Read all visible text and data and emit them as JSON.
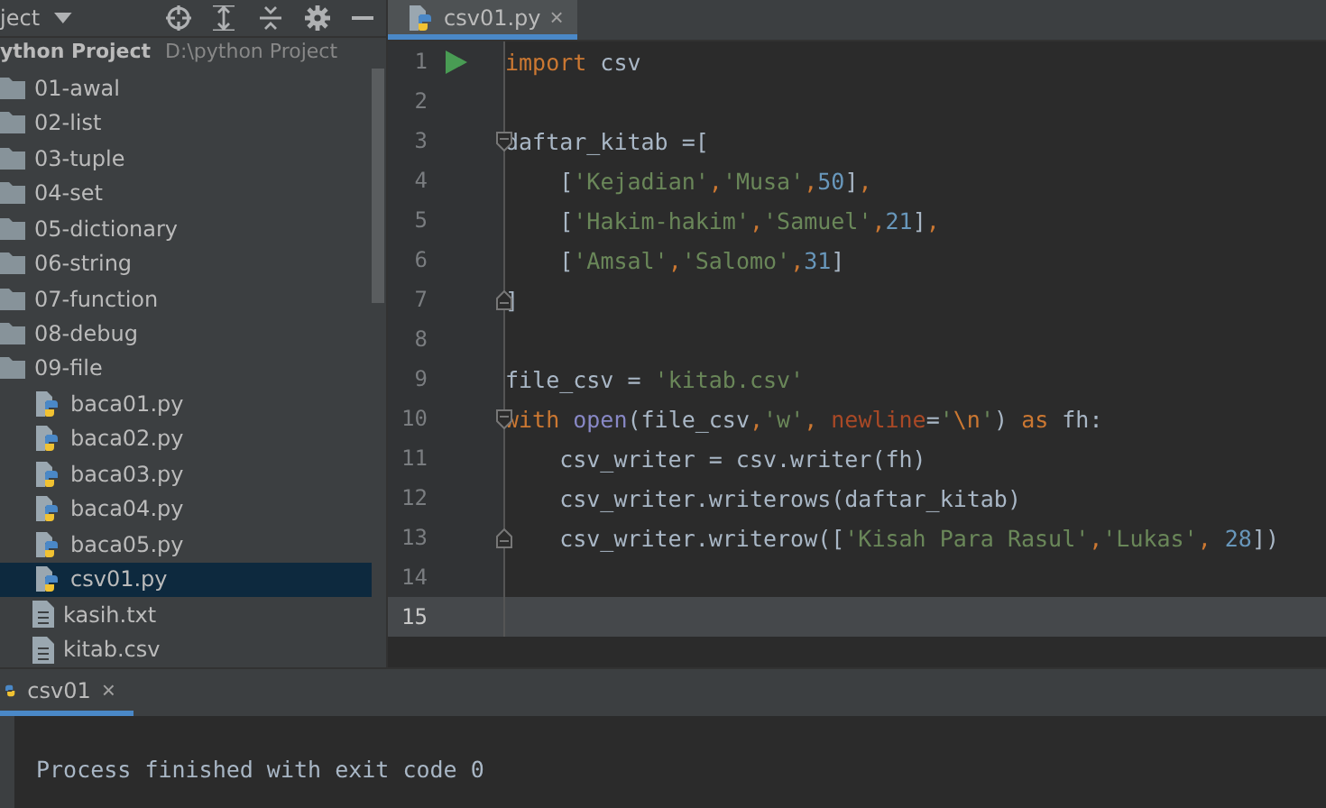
{
  "project_panel": {
    "title": "ject",
    "header": {
      "name": "ython Project",
      "path": "D:\\python Project"
    },
    "items": [
      {
        "kind": "folder",
        "label": "01-awal",
        "selected": false
      },
      {
        "kind": "folder",
        "label": "02-list",
        "selected": false
      },
      {
        "kind": "folder",
        "label": "03-tuple",
        "selected": false
      },
      {
        "kind": "folder",
        "label": "04-set",
        "selected": false
      },
      {
        "kind": "folder",
        "label": "05-dictionary",
        "selected": false
      },
      {
        "kind": "folder",
        "label": "06-string",
        "selected": false
      },
      {
        "kind": "folder",
        "label": "07-function",
        "selected": false
      },
      {
        "kind": "folder",
        "label": "08-debug",
        "selected": false
      },
      {
        "kind": "folder",
        "label": "09-file",
        "selected": false,
        "children": [
          {
            "kind": "python",
            "label": "baca01.py",
            "selected": false
          },
          {
            "kind": "python",
            "label": "baca02.py",
            "selected": false
          },
          {
            "kind": "python",
            "label": "baca03.py",
            "selected": false
          },
          {
            "kind": "python",
            "label": "baca04.py",
            "selected": false
          },
          {
            "kind": "python",
            "label": "baca05.py",
            "selected": false
          },
          {
            "kind": "python",
            "label": "csv01.py",
            "selected": true
          },
          {
            "kind": "text",
            "label": "kasih.txt",
            "selected": false
          },
          {
            "kind": "text",
            "label": "kitab.csv",
            "selected": false
          }
        ]
      }
    ]
  },
  "editor": {
    "tabs": [
      {
        "label": "csv01.py",
        "close": "×",
        "selected": true
      }
    ],
    "lines": [
      {
        "number": "1",
        "run": true,
        "fold_start": false,
        "fold_end": false,
        "current": false,
        "tokens": [
          {
            "kind": "kw",
            "text": "import"
          },
          {
            "kind": "plain",
            "text": " csv"
          }
        ]
      },
      {
        "number": "2",
        "run": false,
        "fold_start": false,
        "fold_end": false,
        "current": false
      },
      {
        "number": "3",
        "run": false,
        "fold_start": true,
        "fold_end": false,
        "current": false,
        "tokens": [
          {
            "kind": "plain",
            "text": "daftar_kitab =["
          }
        ]
      },
      {
        "number": "4",
        "run": false,
        "fold_start": false,
        "fold_end": false,
        "current": false,
        "tokens": [
          {
            "kind": "plain",
            "text": "    ["
          },
          {
            "kind": "str",
            "text": "'Kejadian'"
          },
          {
            "kind": "kw",
            "text": ","
          },
          {
            "kind": "str",
            "text": "'Musa'"
          },
          {
            "kind": "kw",
            "text": ","
          },
          {
            "kind": "num",
            "text": "50"
          },
          {
            "kind": "plain",
            "text": "]"
          },
          {
            "kind": "kw",
            "text": ","
          }
        ]
      },
      {
        "number": "5",
        "run": false,
        "fold_start": false,
        "fold_end": false,
        "current": false,
        "tokens": [
          {
            "kind": "plain",
            "text": "    ["
          },
          {
            "kind": "str",
            "text": "'Hakim-hakim'"
          },
          {
            "kind": "kw",
            "text": ","
          },
          {
            "kind": "str",
            "text": "'Samuel'"
          },
          {
            "kind": "kw",
            "text": ","
          },
          {
            "kind": "num",
            "text": "21"
          },
          {
            "kind": "plain",
            "text": "]"
          },
          {
            "kind": "kw",
            "text": ","
          }
        ]
      },
      {
        "number": "6",
        "run": false,
        "fold_start": false,
        "fold_end": false,
        "current": false,
        "tokens": [
          {
            "kind": "plain",
            "text": "    ["
          },
          {
            "kind": "str",
            "text": "'Amsal'"
          },
          {
            "kind": "kw",
            "text": ","
          },
          {
            "kind": "str",
            "text": "'Salomo'"
          },
          {
            "kind": "kw",
            "text": ","
          },
          {
            "kind": "num",
            "text": "31"
          },
          {
            "kind": "plain",
            "text": "]"
          }
        ]
      },
      {
        "number": "7",
        "run": false,
        "fold_start": false,
        "fold_end": true,
        "current": false,
        "tokens": [
          {
            "kind": "plain",
            "text": "]"
          }
        ]
      },
      {
        "number": "8",
        "run": false,
        "fold_start": false,
        "fold_end": false,
        "current": false
      },
      {
        "number": "9",
        "run": false,
        "fold_start": false,
        "fold_end": false,
        "current": false,
        "tokens": [
          {
            "kind": "plain",
            "text": "file_csv = "
          },
          {
            "kind": "str",
            "text": "'kitab.csv'"
          }
        ]
      },
      {
        "number": "10",
        "run": false,
        "fold_start": true,
        "fold_end": false,
        "current": false,
        "tokens": [
          {
            "kind": "kw",
            "text": "with"
          },
          {
            "kind": "builtin",
            "text": " open"
          },
          {
            "kind": "plain",
            "text": "(file_csv"
          },
          {
            "kind": "kw",
            "text": ","
          },
          {
            "kind": "str",
            "text": "'w'"
          },
          {
            "kind": "kw",
            "text": ", "
          },
          {
            "kind": "param",
            "text": "newline"
          },
          {
            "kind": "plain",
            "text": "="
          },
          {
            "kind": "str",
            "text": "'"
          },
          {
            "kind": "kw",
            "text": "\\n"
          },
          {
            "kind": "str",
            "text": "'"
          },
          {
            "kind": "plain",
            "text": ") "
          },
          {
            "kind": "kw",
            "text": "as"
          },
          {
            "kind": "plain",
            "text": " fh:"
          }
        ]
      },
      {
        "number": "11",
        "run": false,
        "fold_start": false,
        "fold_end": false,
        "current": false,
        "tokens": [
          {
            "kind": "plain",
            "text": "    csv_writer = csv.writer(fh)"
          }
        ]
      },
      {
        "number": "12",
        "run": false,
        "fold_start": false,
        "fold_end": false,
        "current": false,
        "tokens": [
          {
            "kind": "plain",
            "text": "    csv_writer.writerows(daftar_kitab)"
          }
        ]
      },
      {
        "number": "13",
        "run": false,
        "fold_start": false,
        "fold_end": true,
        "current": false,
        "tokens": [
          {
            "kind": "plain",
            "text": "    csv_writer.writerow(["
          },
          {
            "kind": "str",
            "text": "'Kisah Para Rasul'"
          },
          {
            "kind": "kw",
            "text": ","
          },
          {
            "kind": "str",
            "text": "'Lukas'"
          },
          {
            "kind": "kw",
            "text": ", "
          },
          {
            "kind": "num",
            "text": "28"
          },
          {
            "kind": "plain",
            "text": "])"
          }
        ]
      },
      {
        "number": "14",
        "run": false,
        "fold_start": false,
        "fold_end": false,
        "current": false
      },
      {
        "number": "15",
        "run": false,
        "fold_start": false,
        "fold_end": false,
        "current": true
      }
    ]
  },
  "run_panel": {
    "tab": {
      "label": "csv01",
      "close": "×",
      "selected": true
    },
    "output": "Process finished with exit code 0"
  }
}
